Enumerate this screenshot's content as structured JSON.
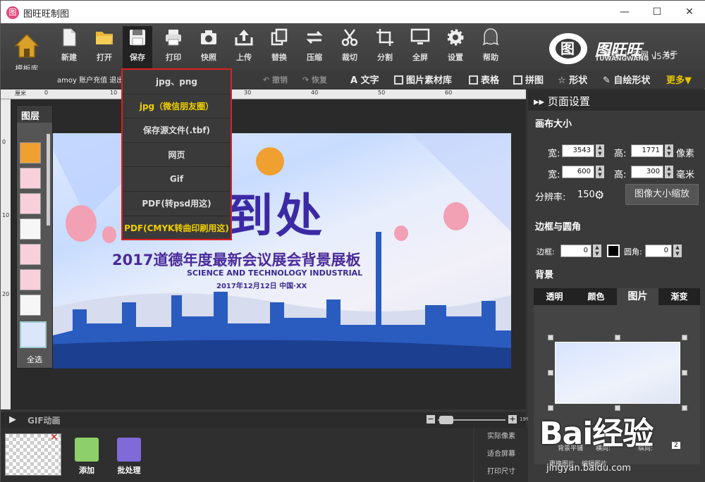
{
  "window": {
    "title": "图旺旺制图",
    "minimize": "—",
    "maximize": "☐",
    "close": "✕"
  },
  "toolbar": {
    "home_label": "模板库",
    "items": [
      {
        "label": "新建",
        "icon": "new-file-icon"
      },
      {
        "label": "打开",
        "icon": "folder-icon"
      },
      {
        "label": "保存",
        "icon": "save-icon"
      },
      {
        "label": "打印",
        "icon": "printer-icon"
      },
      {
        "label": "快照",
        "icon": "camera-icon"
      },
      {
        "label": "上传",
        "icon": "upload-icon"
      },
      {
        "label": "替换",
        "icon": "replace-icon"
      },
      {
        "label": "压缩",
        "icon": "compress-icon"
      },
      {
        "label": "裁切",
        "icon": "scissors-icon"
      },
      {
        "label": "分割",
        "icon": "crop-icon"
      },
      {
        "label": "全屏",
        "icon": "monitor-icon"
      },
      {
        "label": "设置",
        "icon": "gear-icon"
      },
      {
        "label": "帮助",
        "icon": "help-icon"
      }
    ]
  },
  "brand": {
    "name": "图旺旺",
    "sub": "TUWANGWANG",
    "version": "v5.95"
  },
  "toplinks": [
    "教程",
    "|",
    "官网",
    "|",
    "关于"
  ],
  "subbar": {
    "account": "amoy 账户充值 退出",
    "undo": "撤销",
    "redo": "恢复",
    "text": "文字",
    "image_lib": "图片素材库",
    "table": "表格",
    "collage": "拼图",
    "shape": "形状",
    "custom_shape": "自绘形状",
    "more": "更多▼"
  },
  "save_menu": {
    "items": [
      {
        "label": "jpg、png",
        "highlight": false
      },
      {
        "label": "jpg（微信朋友圈）",
        "highlight": true
      },
      {
        "label": "保存源文件(.tbf)",
        "highlight": false
      },
      {
        "label": "网页",
        "highlight": false
      },
      {
        "label": "Gif",
        "highlight": false
      },
      {
        "label": "PDF(转psd用这)",
        "highlight": false
      },
      {
        "label": "PDF(CMYK转曲印刷用这)",
        "highlight": true
      }
    ],
    "border_color": "#e02020"
  },
  "ruler": {
    "unit": "厘米",
    "ticks": [
      "0",
      "10",
      "20",
      "30",
      "40",
      "50",
      "60"
    ],
    "vticks": [
      "0",
      "10",
      "20"
    ]
  },
  "layers": {
    "title": "图层",
    "select_all": "全选"
  },
  "canvas": {
    "big_text": "到处",
    "headline": "2017道德年度最新会议展会背景展板",
    "english": "SCIENCE AND TECHNOLOGY INDUSTRIAL",
    "date": "2017年12月12日  中国·XX"
  },
  "bottom": {
    "gif_label": "GIF动画",
    "zoom_minus": "−",
    "zoom_plus": "+",
    "zoom_pct": "19%",
    "zoom_level": 0.19
  },
  "filmstrip": {
    "add": "添加",
    "batch": "批处理"
  },
  "fit": {
    "actual": "实际像素",
    "fit_screen": "适合屏幕",
    "print_size": "打印尺寸"
  },
  "panel": {
    "title": "页面设置",
    "canvas_size": "画布大小",
    "width_label": "宽:",
    "height_label": "高:",
    "width_px": "3543",
    "height_px": "1771",
    "px_unit": "像素",
    "width_mm": "600",
    "height_mm": "300",
    "mm_unit": "毫米",
    "dpi_label": "分辨率:",
    "dpi": "150",
    "resize_btn": "图像大小缩放",
    "border_section": "边框与圆角",
    "border_label": "边框:",
    "border_val": "0",
    "radius_label": "圆角:",
    "radius_val": "0",
    "bg_section": "背景",
    "bg_tabs": [
      "透明",
      "颜色",
      "图片",
      "渐变"
    ],
    "bg_active": "图片",
    "bg_replace": "更换图片",
    "bg_edit": "编辑图片",
    "bg_tile": "背景平铺",
    "bg_h": "横向:",
    "bg_v": "纵向:",
    "bg_num": "2"
  },
  "watermark": {
    "text": "Bai经验",
    "url": "jingyan.baidu.com"
  }
}
